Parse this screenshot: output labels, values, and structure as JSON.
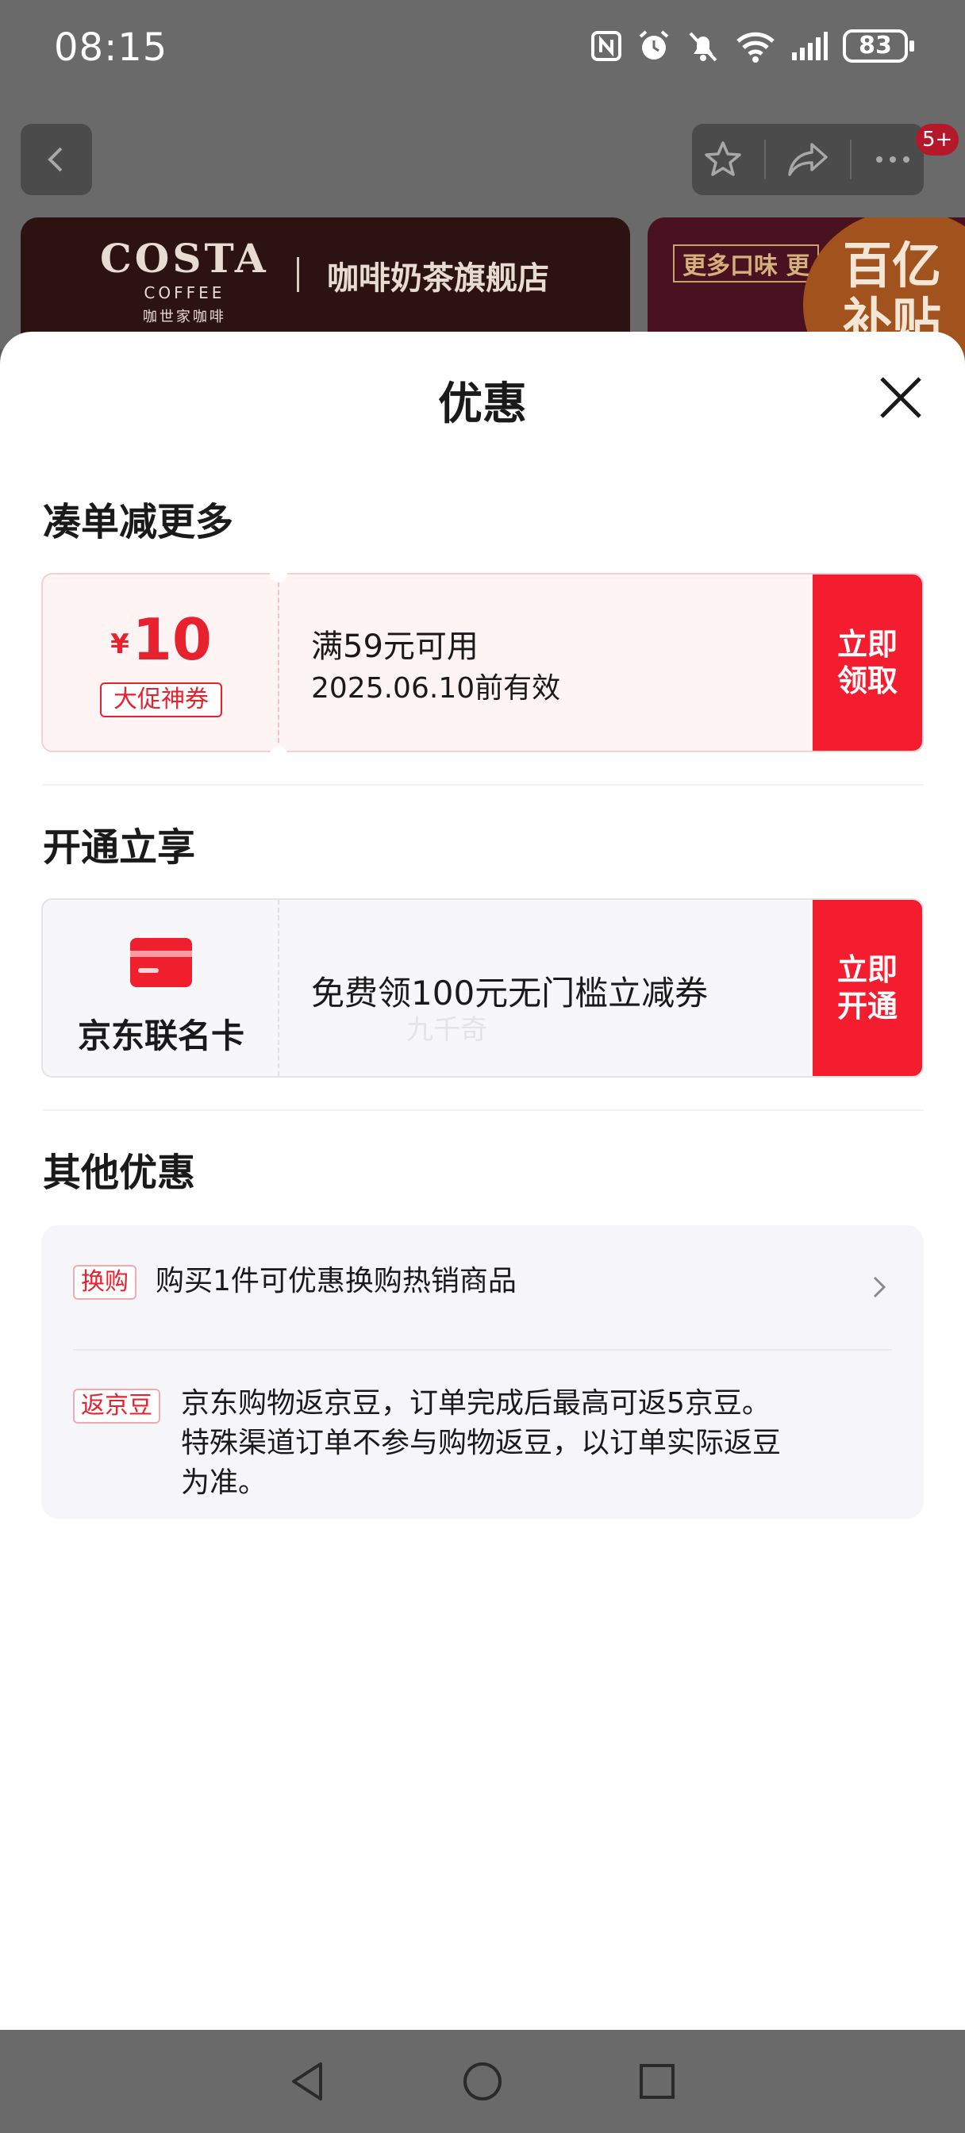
{
  "status_bar": {
    "time": "08:15",
    "battery": "83"
  },
  "header": {
    "badge": "5+"
  },
  "banner": {
    "brand": "COSTA",
    "brand_sub": "COFFEE",
    "brand_cn": "咖世家咖啡",
    "store_name": "咖啡奶茶旗舰店",
    "side_tag": "更多口味 更",
    "side_promo_line1": "百亿",
    "side_promo_line2": "补贴"
  },
  "sheet": {
    "title": "优惠",
    "section_combine": {
      "title": "凑单减更多",
      "coupon": {
        "currency": "¥",
        "amount": "10",
        "tag": "大促神券",
        "condition": "满59元可用",
        "validity": "2025.06.10前有效",
        "cta_line1": "立即",
        "cta_line2": "领取"
      }
    },
    "section_open": {
      "title": "开通立享",
      "card": {
        "name": "京东联名卡",
        "description": "免费领100元无门槛立减券",
        "watermark": "九千奇",
        "cta_line1": "立即",
        "cta_line2": "开通"
      }
    },
    "section_other": {
      "title": "其他优惠",
      "items": [
        {
          "tag": "换购",
          "text": "购买1件可优惠换购热销商品"
        },
        {
          "tag": "返京豆",
          "lines": [
            "京东购物返京豆，订单完成后最高可返5京豆。",
            "特殊渠道订单不参与购物返豆，以订单实际返豆",
            "为准。"
          ]
        }
      ]
    }
  },
  "colors": {
    "accent": "#f41c2f",
    "coupon_bg": "#fff4f4",
    "panel_bg": "#f6f6fa"
  }
}
